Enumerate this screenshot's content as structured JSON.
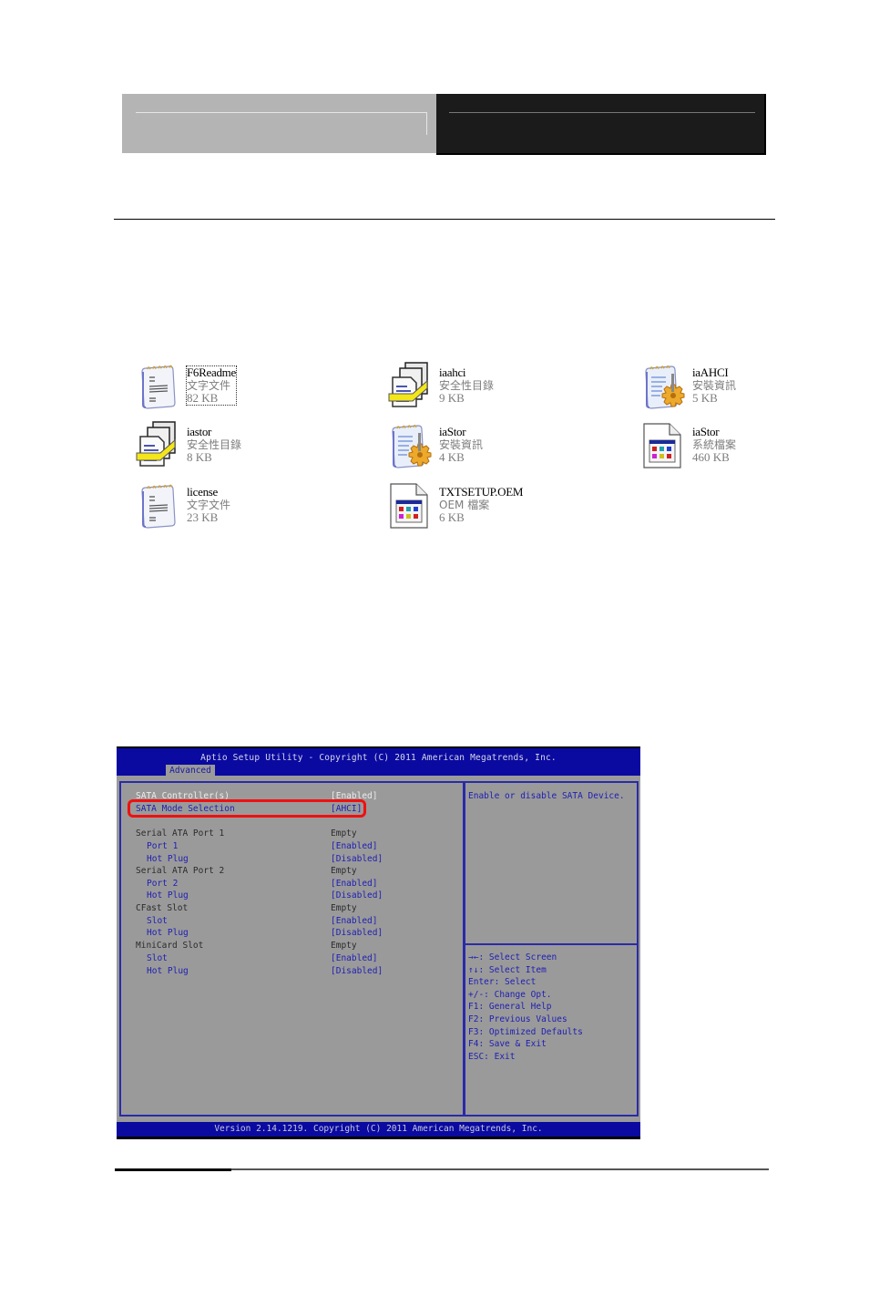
{
  "files": [
    {
      "name": "F6Readme",
      "type": "文字文件",
      "size": "82 KB",
      "icon": "notepad-icon",
      "selected": true
    },
    {
      "name": "iaahci",
      "type": "安全性目錄",
      "size": "9 KB",
      "icon": "security-catalog-icon"
    },
    {
      "name": "iaAHCI",
      "type": "安裝資訊",
      "size": "5 KB",
      "icon": "setup-info-icon"
    },
    {
      "name": "iastor",
      "type": "安全性目錄",
      "size": "8 KB",
      "icon": "security-catalog-icon"
    },
    {
      "name": "iaStor",
      "type": "安裝資訊",
      "size": "4 KB",
      "icon": "setup-info-icon"
    },
    {
      "name": "iaStor",
      "type": "系統檔案",
      "size": "460 KB",
      "icon": "system-file-icon"
    },
    {
      "name": "license",
      "type": "文字文件",
      "size": "23 KB",
      "icon": "notepad-icon"
    },
    {
      "name": "TXTSETUP.OEM",
      "type": "OEM 檔案",
      "size": "6 KB",
      "icon": "system-file-icon"
    }
  ],
  "bios": {
    "title": "Aptio Setup Utility - Copyright (C) 2011 American Megatrends, Inc.",
    "tab": "Advanced",
    "rows": [
      {
        "label": "SATA Controller(s)",
        "value": "[Enabled]",
        "style": "white"
      },
      {
        "label": "SATA Mode Selection",
        "value": "[AHCI]",
        "style": "blue",
        "highlighted": true
      },
      {
        "label": "Serial ATA Port 1",
        "value": "Empty",
        "style": "gray"
      },
      {
        "label": "Port 1",
        "value": "[Enabled]",
        "style": "blue",
        "sub": true
      },
      {
        "label": "Hot Plug",
        "value": "[Disabled]",
        "style": "blue",
        "sub": true
      },
      {
        "label": "Serial ATA Port 2",
        "value": "Empty",
        "style": "gray"
      },
      {
        "label": "Port 2",
        "value": "[Enabled]",
        "style": "blue",
        "sub": true
      },
      {
        "label": "Hot Plug",
        "value": "[Disabled]",
        "style": "blue",
        "sub": true
      },
      {
        "label": "CFast Slot",
        "value": "Empty",
        "style": "gray"
      },
      {
        "label": "Slot",
        "value": "[Enabled]",
        "style": "blue",
        "sub": true
      },
      {
        "label": "Hot Plug",
        "value": "[Disabled]",
        "style": "blue",
        "sub": true
      },
      {
        "label": "MiniCard Slot",
        "value": "Empty",
        "style": "gray"
      },
      {
        "label": "Slot",
        "value": "[Enabled]",
        "style": "blue",
        "sub": true
      },
      {
        "label": "Hot Plug",
        "value": "[Disabled]",
        "style": "blue",
        "sub": true
      }
    ],
    "help_text": "Enable or disable SATA Device.",
    "keys": [
      "→←: Select Screen",
      "↑↓: Select Item",
      "Enter: Select",
      "+/-: Change Opt.",
      "F1: General Help",
      "F2: Previous Values",
      "F3: Optimized Defaults",
      "F4: Save & Exit",
      "ESC: Exit"
    ],
    "footer": "Version 2.14.1219. Copyright (C) 2011 American Megatrends, Inc.",
    "colors": {
      "title_bar": "#0a0aa0",
      "panel_bg": "#9a9a9a",
      "highlight": "#f01010",
      "option": "#1e1eb4"
    }
  }
}
